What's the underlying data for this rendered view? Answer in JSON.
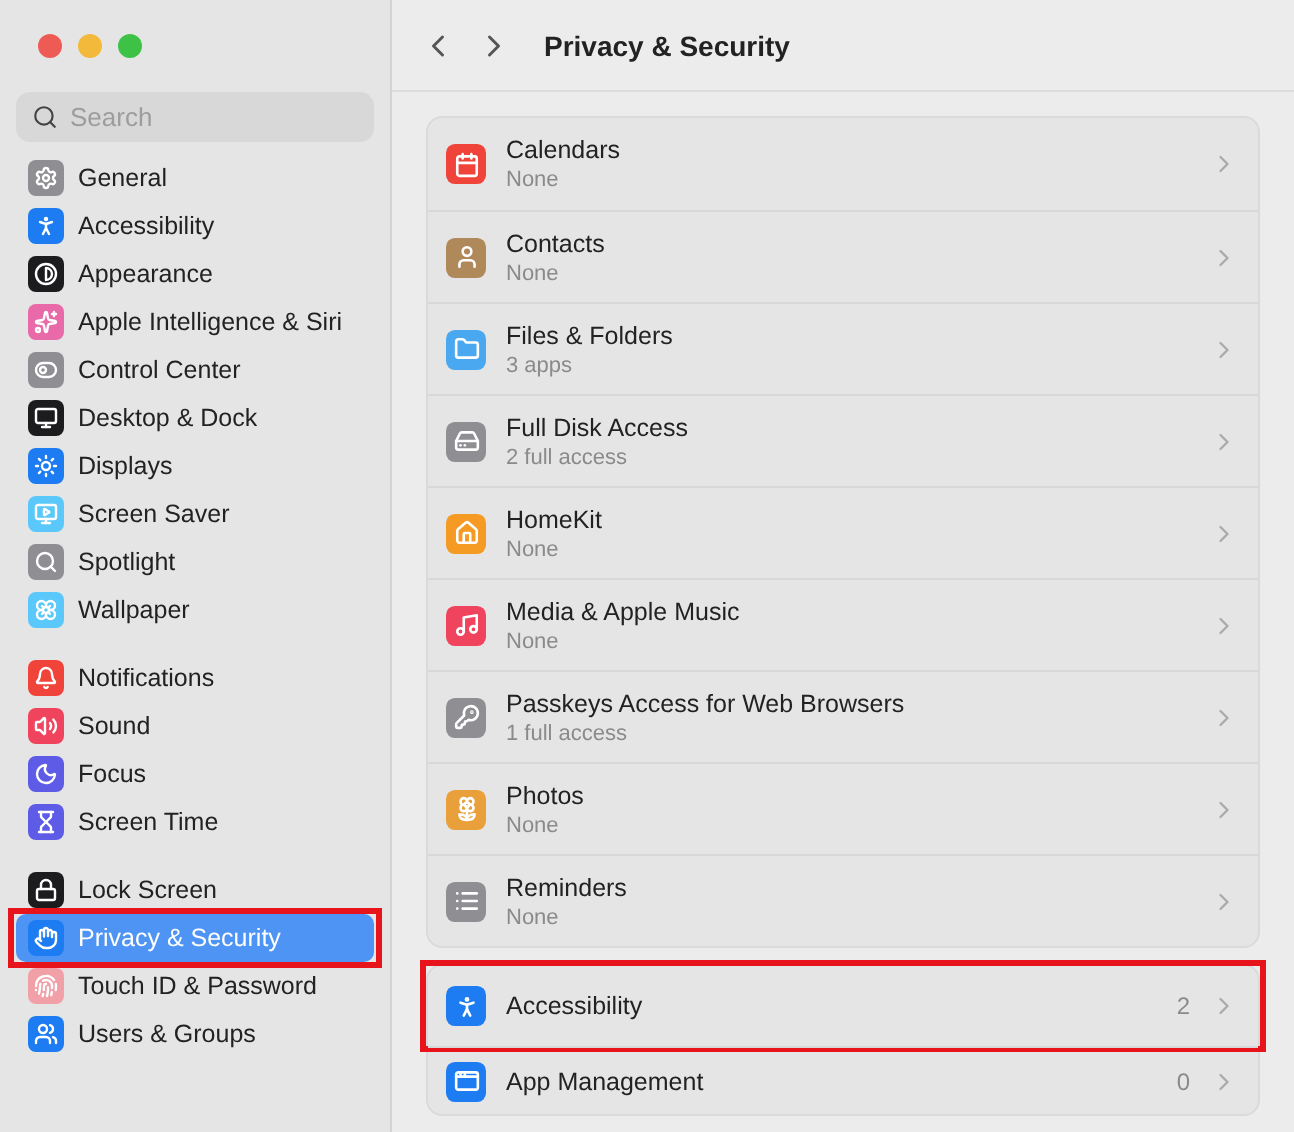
{
  "window": {
    "title": "Privacy & Security"
  },
  "search": {
    "placeholder": "Search"
  },
  "sidebar": {
    "groups": [
      {
        "items": [
          {
            "label": "General",
            "selected": false,
            "highlighted": false,
            "color": "#8e8e93"
          },
          {
            "label": "Accessibility",
            "selected": false,
            "highlighted": false,
            "color": "#1d7cf2"
          },
          {
            "label": "Appearance",
            "selected": false,
            "highlighted": false,
            "color": "#1c1c1e"
          },
          {
            "label": "Apple Intelligence & Siri",
            "selected": false,
            "highlighted": false,
            "color": "#e86aa8"
          },
          {
            "label": "Control Center",
            "selected": false,
            "highlighted": false,
            "color": "#8e8e93"
          },
          {
            "label": "Desktop & Dock",
            "selected": false,
            "highlighted": false,
            "color": "#1c1c1e"
          },
          {
            "label": "Displays",
            "selected": false,
            "highlighted": false,
            "color": "#1d7cf2"
          },
          {
            "label": "Screen Saver",
            "selected": false,
            "highlighted": false,
            "color": "#5ac8fa"
          },
          {
            "label": "Spotlight",
            "selected": false,
            "highlighted": false,
            "color": "#8e8e93"
          },
          {
            "label": "Wallpaper",
            "selected": false,
            "highlighted": false,
            "color": "#5ac8fa"
          }
        ]
      },
      {
        "items": [
          {
            "label": "Notifications",
            "selected": false,
            "highlighted": false,
            "color": "#f0443a"
          },
          {
            "label": "Sound",
            "selected": false,
            "highlighted": false,
            "color": "#f0445e"
          },
          {
            "label": "Focus",
            "selected": false,
            "highlighted": false,
            "color": "#5e5ce6"
          },
          {
            "label": "Screen Time",
            "selected": false,
            "highlighted": false,
            "color": "#5e5ce6"
          }
        ]
      },
      {
        "items": [
          {
            "label": "Lock Screen",
            "selected": false,
            "highlighted": false,
            "color": "#1c1c1e"
          },
          {
            "label": "Privacy & Security",
            "selected": true,
            "highlighted": true,
            "color": "#1d7cf2"
          },
          {
            "label": "Touch ID & Password",
            "selected": false,
            "highlighted": false,
            "color": "#f2a0a8"
          },
          {
            "label": "Users & Groups",
            "selected": false,
            "highlighted": false,
            "color": "#1d7cf2"
          }
        ]
      }
    ]
  },
  "sections": [
    {
      "rows": [
        {
          "title": "Calendars",
          "detail": "None",
          "color": "#f0443a"
        },
        {
          "title": "Contacts",
          "detail": "None",
          "color": "#b0895a"
        },
        {
          "title": "Files & Folders",
          "detail": "3 apps",
          "color": "#4aa8f0"
        },
        {
          "title": "Full Disk Access",
          "detail": "2 full access",
          "color": "#8e8e93"
        },
        {
          "title": "HomeKit",
          "detail": "None",
          "color": "#f59a23"
        },
        {
          "title": "Media & Apple Music",
          "detail": "None",
          "color": "#f0445e"
        },
        {
          "title": "Passkeys Access for Web Browsers",
          "detail": "1 full access",
          "color": "#8e8e93"
        },
        {
          "title": "Photos",
          "detail": "None",
          "color": "#e9a03a"
        },
        {
          "title": "Reminders",
          "detail": "None",
          "color": "#8e8e93"
        }
      ]
    },
    {
      "rows": [
        {
          "title": "Accessibility",
          "count": "2",
          "highlighted": true,
          "color": "#1d7cf2"
        },
        {
          "title": "App Management",
          "count": "0",
          "highlighted": false,
          "color": "#1d7cf2"
        }
      ]
    }
  ]
}
